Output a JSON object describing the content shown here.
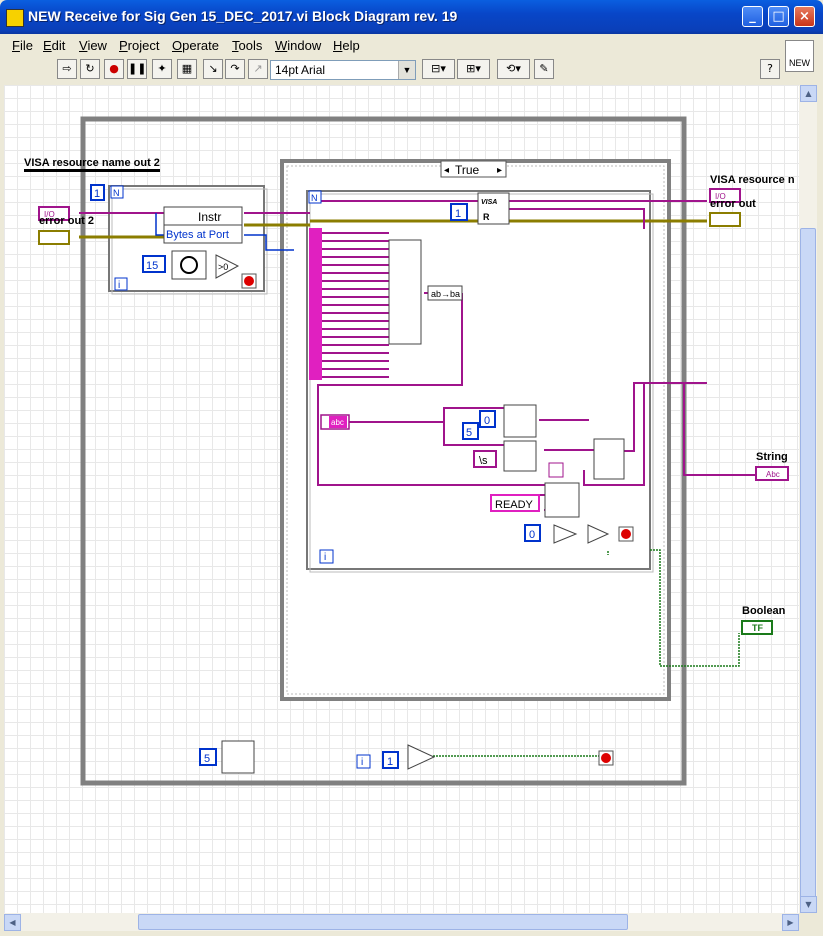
{
  "window": {
    "title": "NEW Receive for Sig Gen 15_DEC_2017.vi Block Diagram rev. 19",
    "buttons": {
      "minimize": "_",
      "maximize": "□",
      "close": "×"
    }
  },
  "menu": [
    "File",
    "Edit",
    "View",
    "Project",
    "Operate",
    "Tools",
    "Window",
    "Help"
  ],
  "toolbar": {
    "font_selector": "14pt Arial",
    "help_label": "?",
    "vi_icon_label": "NEW"
  },
  "diagram": {
    "labels": {
      "visa_out_2": "VISA resource name out 2",
      "error_out_2": "error out 2",
      "visa_out": "VISA resource n",
      "error_out": "error out",
      "string": "String",
      "boolean": "Boolean"
    },
    "case_selector": "True",
    "inner_nodes": {
      "instr": "Instr",
      "bytes_at_port": "Bytes at Port",
      "visa_read": "VISA",
      "ready": "READY",
      "string_to_bytes": "ab→ba",
      "iteration_terminal": "i",
      "count_terminal": "N"
    },
    "constants": {
      "one_a": "1",
      "one_b": "1",
      "one_c": "1",
      "fifteen": "15",
      "five_a": "5",
      "five_b": "5",
      "zero_a": "0",
      "zero_b": "0",
      "backslash_s": "\\s",
      "compare_zero": ">0",
      "io_a": "I/O",
      "io_b": "I/O",
      "abc_a": "abc",
      "abc_b": "Abc",
      "tf": "TF"
    }
  }
}
